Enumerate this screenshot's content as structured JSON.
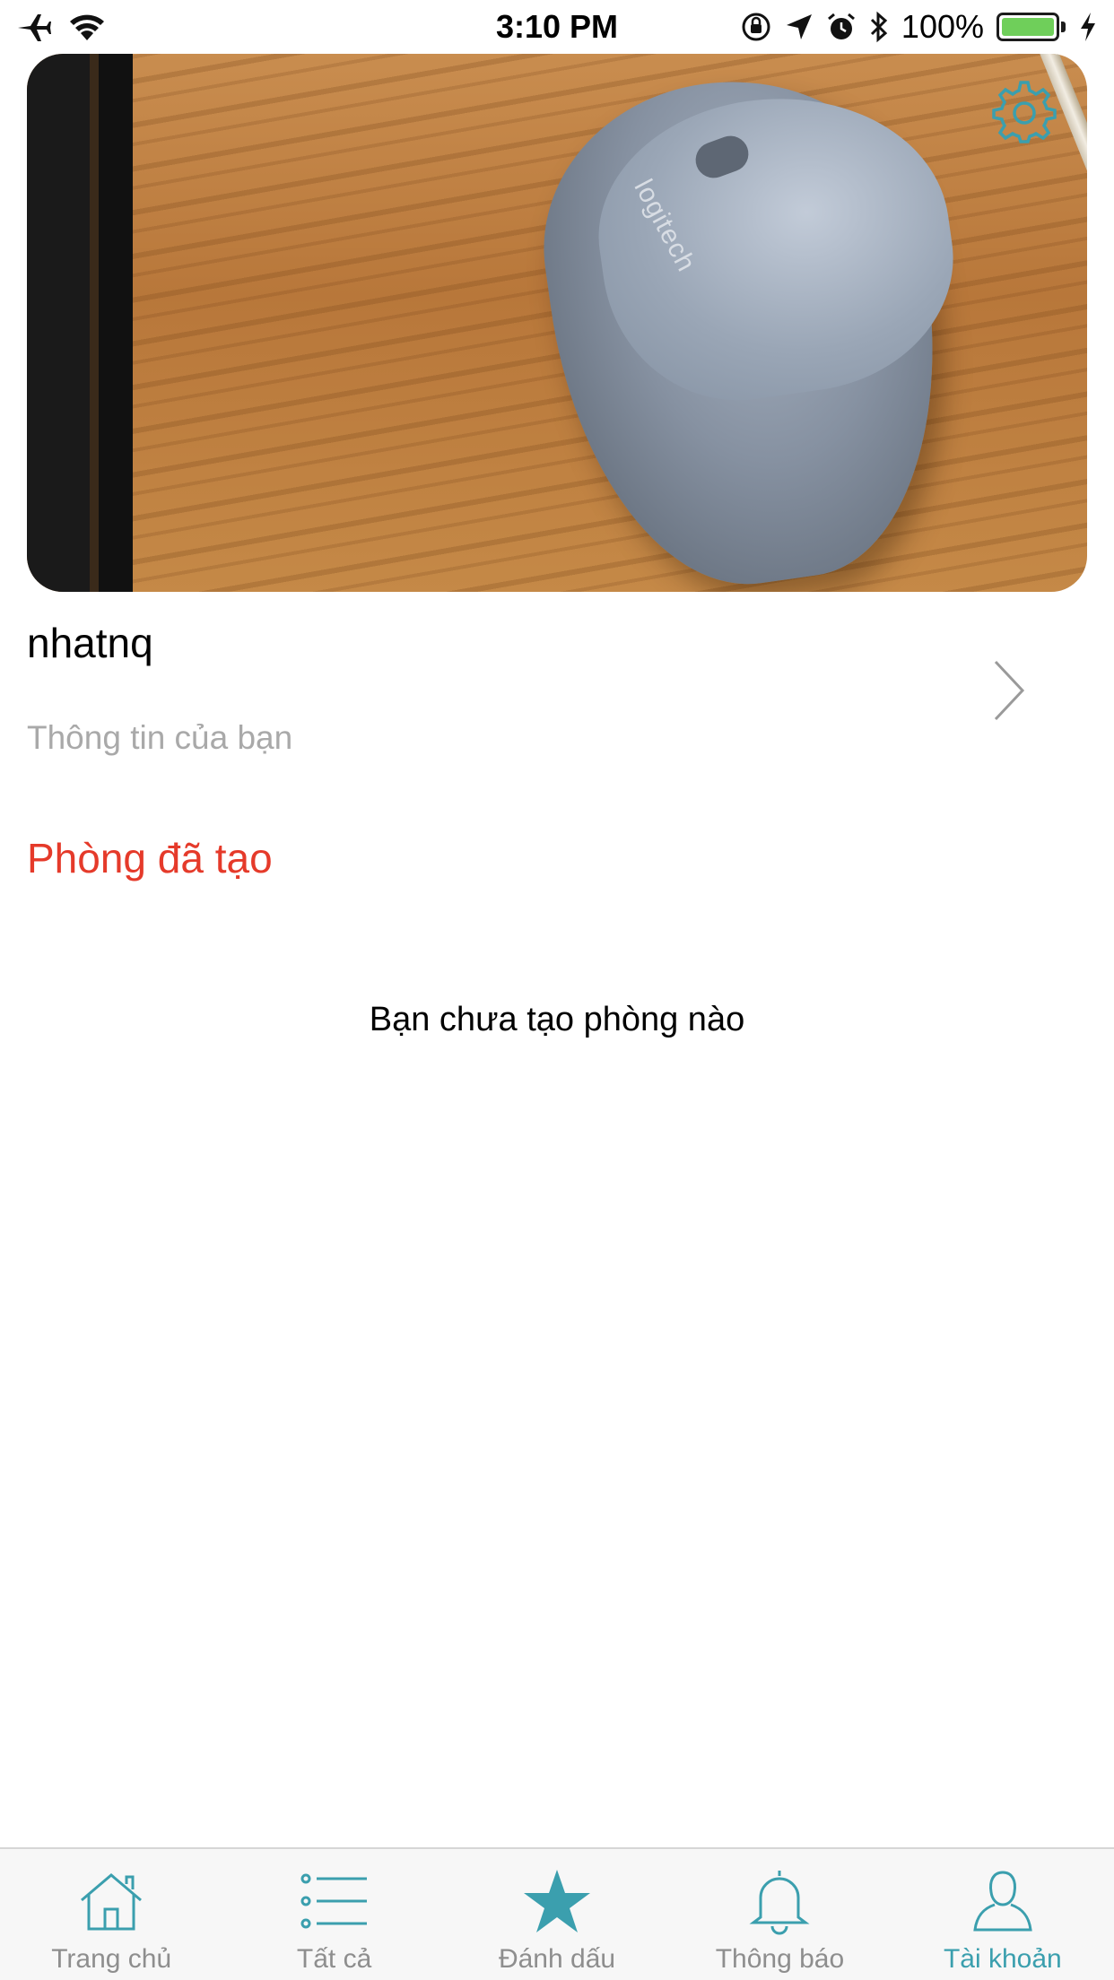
{
  "status_bar": {
    "time": "3:10 PM",
    "battery_percent": "100%",
    "icons": [
      "airplane-icon",
      "wifi-icon",
      "orientation-lock-icon",
      "location-icon",
      "alarm-icon",
      "bluetooth-icon",
      "battery-icon",
      "charging-icon"
    ]
  },
  "profile": {
    "username": "nhatnq",
    "subtitle": "Thông tin của bạn"
  },
  "rooms": {
    "title": "Phòng đã tạo",
    "empty_message": "Bạn chưa tạo phòng nào"
  },
  "cover_photo": {
    "mouse_brand": "logitech"
  },
  "tab_bar": {
    "active_index": 4,
    "tabs": [
      {
        "label": "Trang chủ",
        "icon": "home-icon"
      },
      {
        "label": "Tất cả",
        "icon": "list-icon"
      },
      {
        "label": "Đánh dấu",
        "icon": "star-icon"
      },
      {
        "label": "Thông báo",
        "icon": "bell-icon"
      },
      {
        "label": "Tài khoản",
        "icon": "user-icon"
      }
    ]
  },
  "colors": {
    "accent": "#3b9fae",
    "section_title": "#e53a2a",
    "subtitle": "#a9a9a9",
    "tab_inactive": "#8e8e8e",
    "battery": "#6fcf5a"
  }
}
